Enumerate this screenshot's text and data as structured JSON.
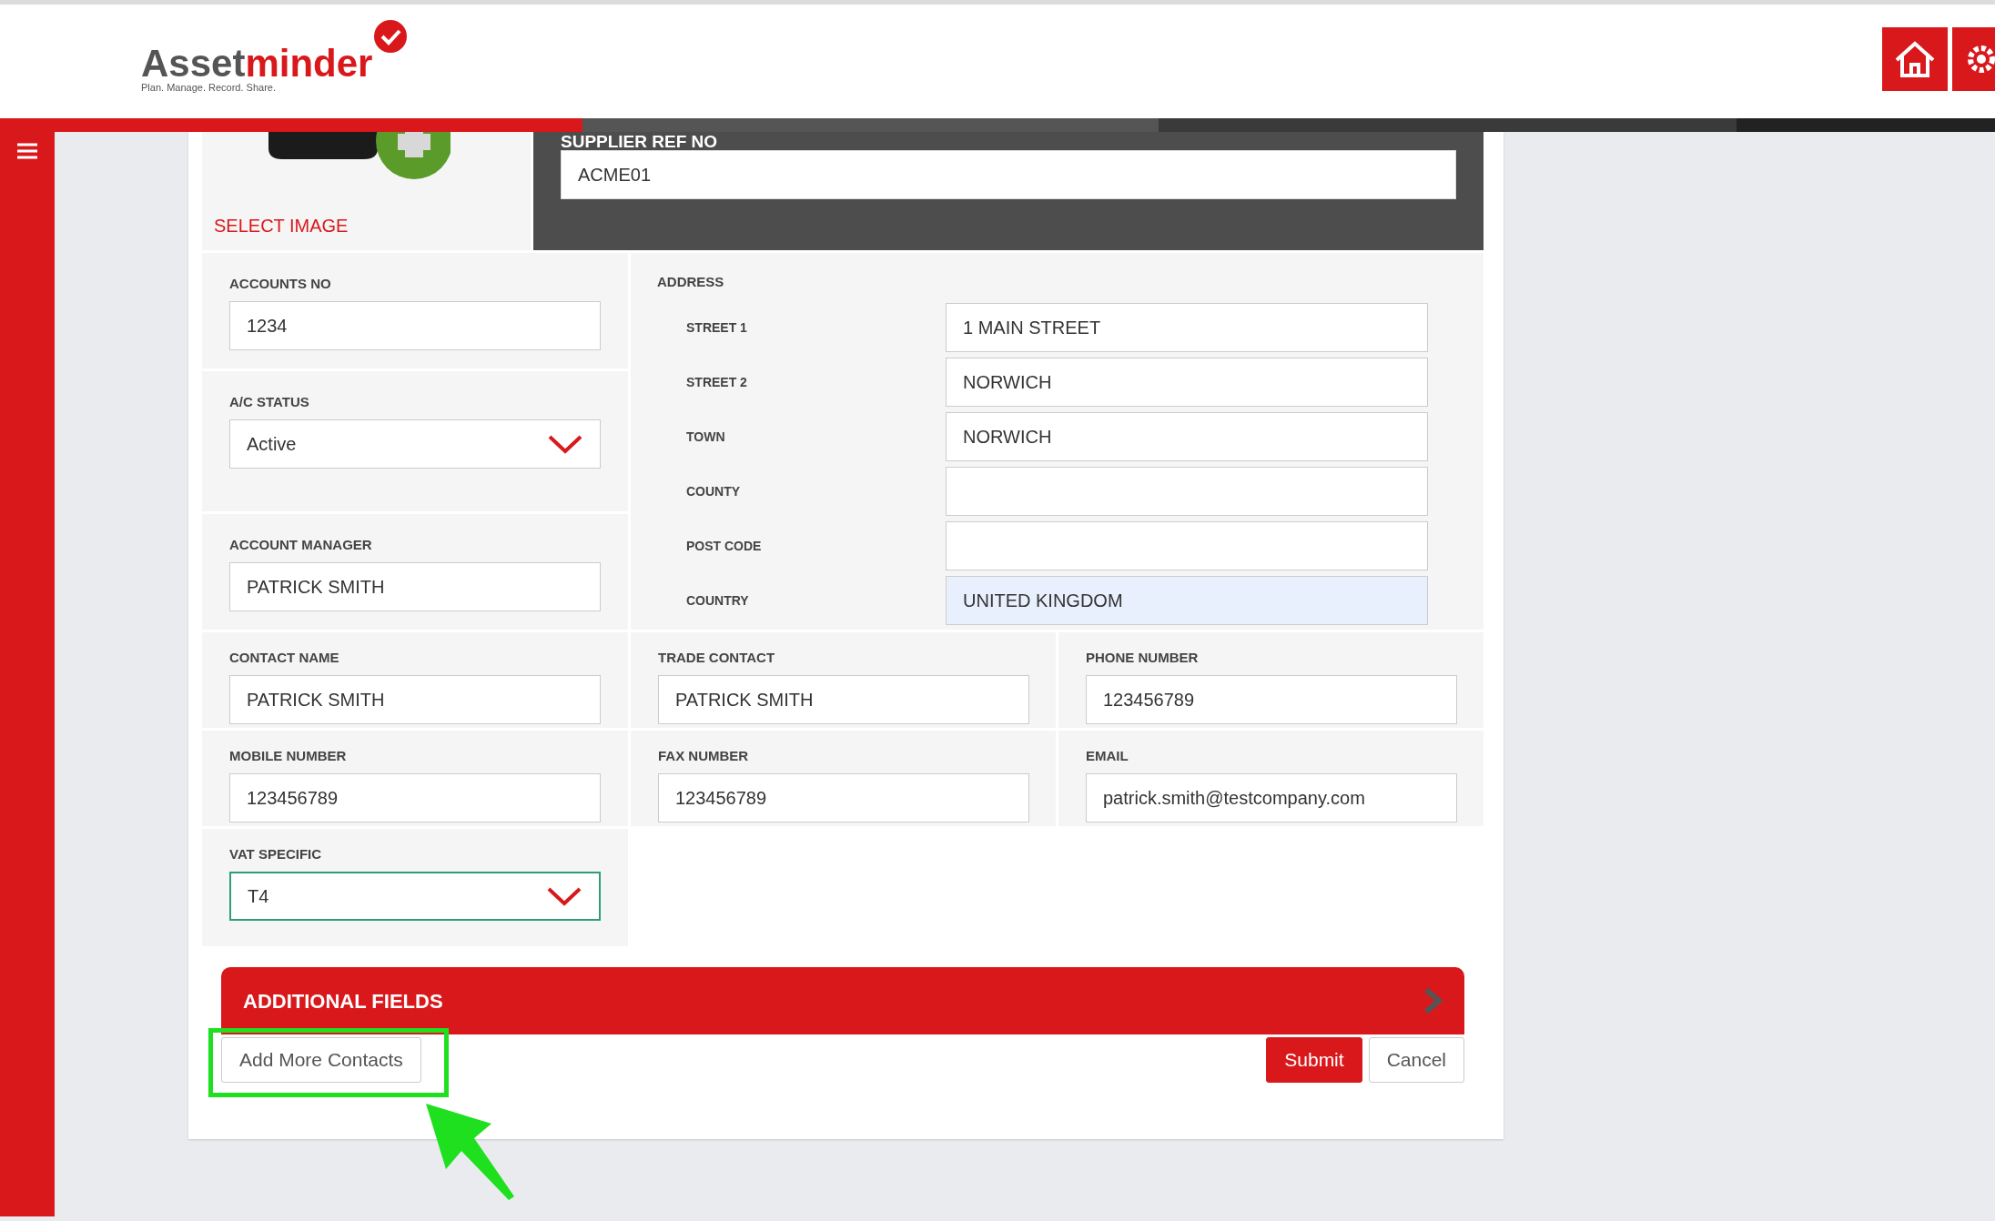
{
  "header": {
    "logo": {
      "brand_dark": "Asset",
      "brand_red": "minder",
      "tagline": "Plan. Manage. Record. Share."
    }
  },
  "image_panel": {
    "action": "SELECT IMAGE"
  },
  "supplier_ref": {
    "label": "SUPPLIER REF NO",
    "value": "ACME01"
  },
  "left_fields": [
    {
      "kind": "text",
      "label": "ACCOUNTS NO",
      "value": "1234"
    },
    {
      "kind": "select",
      "label": "A/C STATUS",
      "value": "Active",
      "focused": false
    },
    {
      "kind": "text",
      "label": "ACCOUNT MANAGER",
      "value": "PATRICK SMITH"
    }
  ],
  "address": {
    "label": "ADDRESS",
    "lines": [
      {
        "label": "STREET 1",
        "value": "1 MAIN STREET",
        "autofilled": false
      },
      {
        "label": "STREET 2",
        "value": "NORWICH",
        "autofilled": false
      },
      {
        "label": "TOWN",
        "value": "NORWICH",
        "autofilled": false
      },
      {
        "label": "COUNTY",
        "autofilled": false
      },
      {
        "label": "POST CODE",
        "autofilled": false
      },
      {
        "label": "COUNTRY",
        "value": "UNITED KINGDOM",
        "autofilled": true
      }
    ]
  },
  "contact_rows": [
    [
      {
        "kind": "text",
        "label": "CONTACT NAME",
        "value": "PATRICK SMITH"
      },
      {
        "kind": "text",
        "label": "TRADE CONTACT",
        "value": "PATRICK SMITH"
      },
      {
        "kind": "text",
        "label": "PHONE NUMBER",
        "value": "123456789"
      }
    ],
    [
      {
        "kind": "text",
        "label": "MOBILE NUMBER",
        "value": "123456789"
      },
      {
        "kind": "text",
        "label": "FAX NUMBER",
        "value": "123456789"
      },
      {
        "kind": "text",
        "label": "EMAIL",
        "value": "patrick.smith@testcompany.com"
      }
    ],
    [
      {
        "kind": "select",
        "label": "VAT SPECIFIC",
        "value": "T4",
        "focused": true
      }
    ]
  ],
  "additional_fields": {
    "title": "ADDITIONAL FIELDS",
    "expanded": false
  },
  "buttons": [
    {
      "kind": "secondary",
      "label": "Add More Contacts",
      "highlighted": true
    },
    {
      "kind": "primary",
      "label": "Submit",
      "highlighted": false
    },
    {
      "kind": "secondary",
      "label": "Cancel",
      "highlighted": false
    }
  ]
}
